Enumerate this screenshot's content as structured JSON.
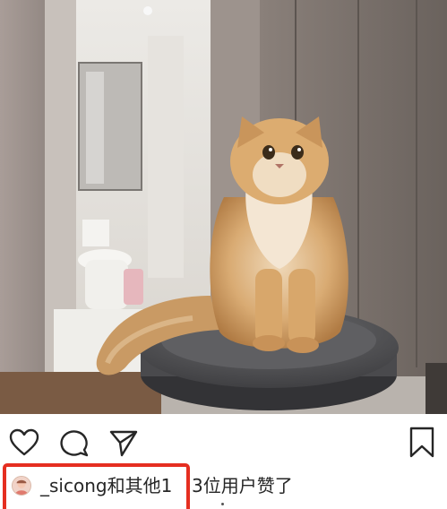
{
  "post": {
    "photo_icon": "cat-photo",
    "actions": {
      "like_icon": "heart-icon",
      "comment_icon": "comment-icon",
      "share_icon": "send-icon",
      "save_icon": "bookmark-icon"
    },
    "likes": {
      "username": "_sicong和其他1",
      "rest": "3位用户赞了",
      "highlight_color": "#e52e20"
    }
  }
}
